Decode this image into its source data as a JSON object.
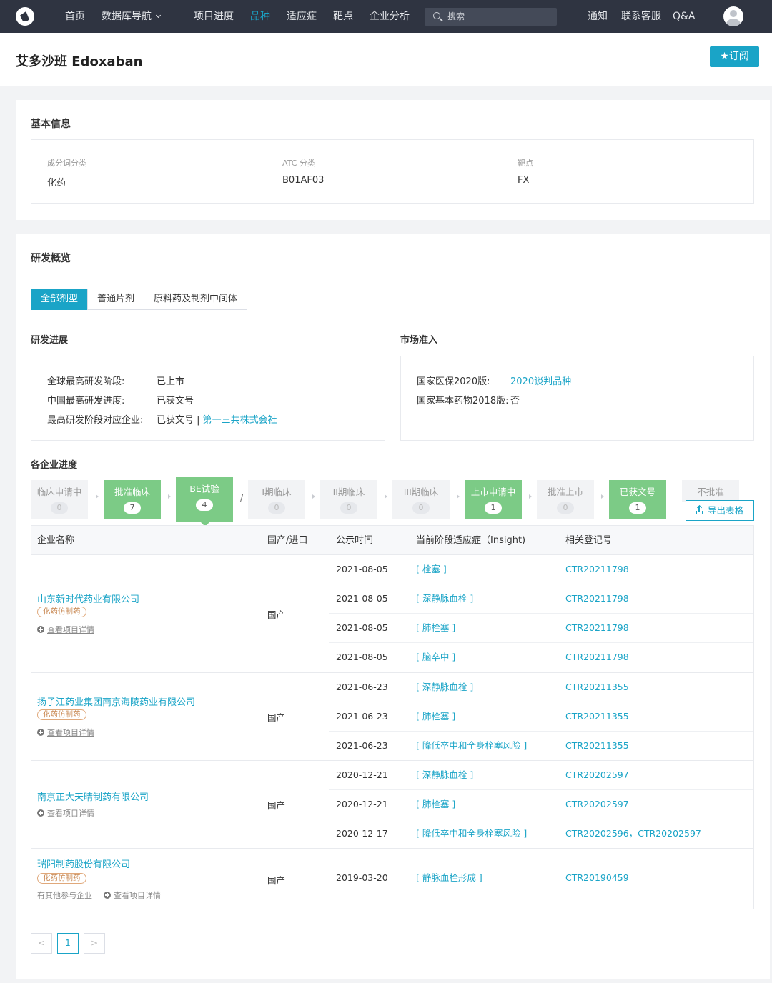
{
  "nav": {
    "items": [
      "首页",
      "数据库导航",
      "项目进度",
      "品种",
      "适应症",
      "靶点",
      "企业分析"
    ],
    "search_placeholder": "搜索",
    "right": [
      "通知",
      "联系客服",
      "Q&A"
    ]
  },
  "header": {
    "title": "艾多沙班 Edoxaban",
    "subscribe": "★订阅"
  },
  "basic": {
    "title": "基本信息",
    "fields": [
      {
        "label": "成分词分类",
        "value": "化药"
      },
      {
        "label": "ATC 分类",
        "value": "B01AF03"
      },
      {
        "label": "靶点",
        "value": "FX"
      }
    ]
  },
  "rd": {
    "title": "研发概览",
    "tabs": [
      "全部剂型",
      "普通片剂",
      "原料药及制剂中间体"
    ],
    "progress": {
      "title": "研发进展",
      "rows": [
        {
          "label": "全球最高研发阶段:",
          "value": "已上市"
        },
        {
          "label": "中国最高研发进度:",
          "value": "已获文号"
        },
        {
          "label": "最高研发阶段对应企业:",
          "value": "已获文号 | ",
          "link": "第一三共株式会社"
        }
      ]
    },
    "market": {
      "title": "市场准入",
      "rows": [
        {
          "label": "国家医保2020版:",
          "value": "2020谈判品种"
        },
        {
          "label": "国家基本药物2018版:",
          "value": "否"
        }
      ]
    },
    "companies_title": "各企业进度",
    "stages": [
      {
        "label": "临床申请中",
        "count": "0",
        "active": false
      },
      {
        "label": "批准临床",
        "count": "7",
        "active": true
      },
      {
        "label": "BE试验",
        "count": "4",
        "active": true
      },
      {
        "label": "I期临床",
        "count": "0",
        "active": false
      },
      {
        "label": "II期临床",
        "count": "0",
        "active": false
      },
      {
        "label": "III期临床",
        "count": "0",
        "active": false
      },
      {
        "label": "上市申请中",
        "count": "1",
        "active": true
      },
      {
        "label": "批准上市",
        "count": "0",
        "active": false
      },
      {
        "label": "已获文号",
        "count": "1",
        "active": true
      },
      {
        "label": "不批准",
        "count": "",
        "active": false
      }
    ],
    "slash": "/",
    "export": "导出表格"
  },
  "table": {
    "headers": [
      "企业名称",
      "国产/进口",
      "公示时间",
      "当前阶段适应症（Insight)",
      "相关登记号"
    ],
    "groups": [
      {
        "company": "山东新时代药业有限公司",
        "tag": "化药仿制药",
        "detail": "查看项目详情",
        "origin": "国产",
        "rows": [
          [
            "2021-08-05",
            "[ 栓塞 ]",
            "CTR20211798"
          ],
          [
            "2021-08-05",
            "[ 深静脉血栓 ]",
            "CTR20211798"
          ],
          [
            "2021-08-05",
            "[ 肺栓塞 ]",
            "CTR20211798"
          ],
          [
            "2021-08-05",
            "[ 脑卒中 ]",
            "CTR20211798"
          ]
        ]
      },
      {
        "company": "扬子江药业集团南京海陵药业有限公司",
        "tag": "化药仿制药",
        "detail": "查看项目详情",
        "origin": "国产",
        "rows": [
          [
            "2021-06-23",
            "[ 深静脉血栓 ]",
            "CTR20211355"
          ],
          [
            "2021-06-23",
            "[ 肺栓塞 ]",
            "CTR20211355"
          ],
          [
            "2021-06-23",
            "[ 降低卒中和全身栓塞风险 ]",
            "CTR20211355"
          ]
        ]
      },
      {
        "company": "南京正大天晴制药有限公司",
        "tag": "",
        "detail": "查看项目详情",
        "origin": "国产",
        "rows": [
          [
            "2020-12-21",
            "[ 深静脉血栓 ]",
            "CTR20202597"
          ],
          [
            "2020-12-21",
            "[ 肺栓塞 ]",
            "CTR20202597"
          ],
          [
            "2020-12-17",
            "[ 降低卒中和全身栓塞风险 ]",
            "CTR20202596，CTR20202597"
          ]
        ]
      },
      {
        "company": "瑞阳制药股份有限公司",
        "tag": "化药仿制药",
        "detail": "查看项目详情",
        "other": "有其他参与企业",
        "origin": "国产",
        "rows": [
          [
            "2019-03-20",
            "[ 静脉血栓形成 ]",
            "CTR20190459"
          ]
        ]
      }
    ]
  },
  "pager": {
    "prev": "<",
    "current": "1",
    "next": ">"
  },
  "colors": {
    "accent": "#1aa4c7",
    "nav_bg": "#2f3441",
    "stage_green": "#7ccb86"
  }
}
